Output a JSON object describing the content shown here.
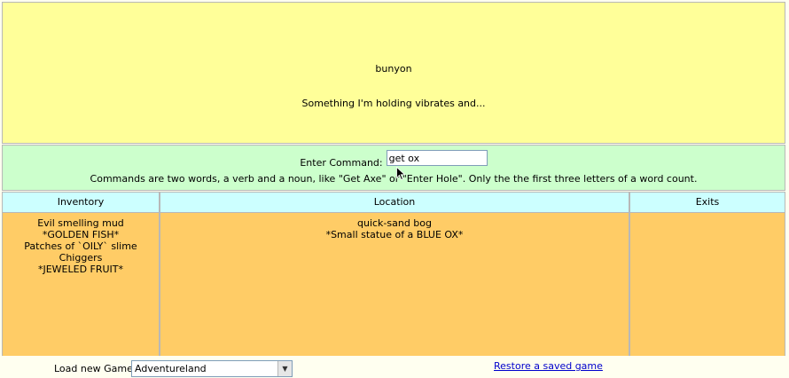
{
  "message": {
    "line1": "bunyon",
    "line2": "Something I'm holding vibrates and..."
  },
  "command": {
    "label": "Enter Command:",
    "value": "get ox",
    "hint": "Commands are two words, a verb and a noun, like \"Get Axe\" or \"Enter Hole\". Only the the first three letters of a word count."
  },
  "inventory": {
    "header": "Inventory",
    "items": [
      "Evil smelling mud",
      "*GOLDEN FISH*",
      "Patches of `OILY` slime",
      "Chiggers",
      "*JEWELED FRUIT*"
    ]
  },
  "location": {
    "header": "Location",
    "items": [
      "quick-sand bog",
      "*Small statue of a BLUE OX*"
    ]
  },
  "exits": {
    "header": "Exits",
    "items": []
  },
  "footer": {
    "load_label": "Load new Game:",
    "game_select": "Adventureland",
    "restore_link": "Restore a saved game"
  },
  "icons": {
    "dropdown": "chevron-down-icon",
    "cursor": "mouse-pointer-icon"
  },
  "colors": {
    "message_bg": "#ffff99",
    "command_bg": "#ccffcc",
    "header_bg": "#ccffff",
    "panel_bg": "#ffcc66",
    "link": "#0000cc"
  }
}
